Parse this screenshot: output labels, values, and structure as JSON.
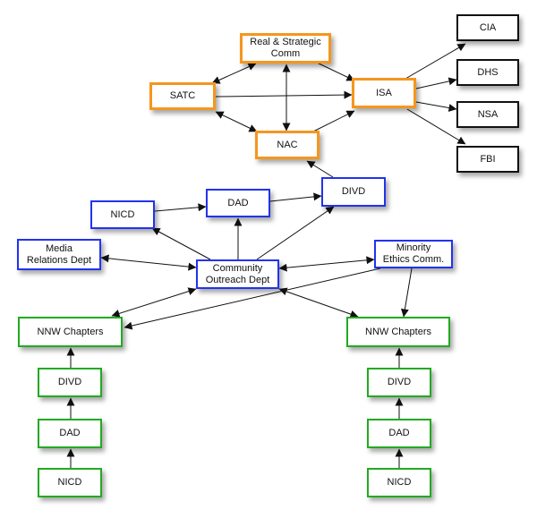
{
  "diagram": {
    "nodes": [
      {
        "id": "real-strategic-comm",
        "label": "Real & Strategic\nComm",
        "group": "orange"
      },
      {
        "id": "satc",
        "label": "SATC",
        "group": "orange"
      },
      {
        "id": "isa",
        "label": "ISA",
        "group": "orange"
      },
      {
        "id": "nac",
        "label": "NAC",
        "group": "orange"
      },
      {
        "id": "cia",
        "label": "CIA",
        "group": "black"
      },
      {
        "id": "dhs",
        "label": "DHS",
        "group": "black"
      },
      {
        "id": "nsa",
        "label": "NSA",
        "group": "black"
      },
      {
        "id": "fbi",
        "label": "FBI",
        "group": "black"
      },
      {
        "id": "divd-top",
        "label": "DIVD",
        "group": "blue"
      },
      {
        "id": "dad-top",
        "label": "DAD",
        "group": "blue"
      },
      {
        "id": "nicd-top",
        "label": "NICD",
        "group": "blue"
      },
      {
        "id": "media-relations",
        "label": "Media\nRelations Dept",
        "group": "blue"
      },
      {
        "id": "community-outreach",
        "label": "Community\nOutreach Dept",
        "group": "blue"
      },
      {
        "id": "minority-ethics",
        "label": "Minority\nEthics Comm.",
        "group": "blue"
      },
      {
        "id": "nnw-left",
        "label": "NNW Chapters",
        "group": "green"
      },
      {
        "id": "nnw-right",
        "label": "NNW Chapters",
        "group": "green"
      },
      {
        "id": "divd-left",
        "label": "DIVD",
        "group": "green"
      },
      {
        "id": "dad-left",
        "label": "DAD",
        "group": "green"
      },
      {
        "id": "nicd-left",
        "label": "NICD",
        "group": "green"
      },
      {
        "id": "divd-right",
        "label": "DIVD",
        "group": "green"
      },
      {
        "id": "dad-right",
        "label": "DAD",
        "group": "green"
      },
      {
        "id": "nicd-right",
        "label": "NICD",
        "group": "green"
      }
    ],
    "edges": [
      {
        "from": "real-strategic-comm",
        "to": "satc",
        "direction": "both"
      },
      {
        "from": "real-strategic-comm",
        "to": "isa",
        "direction": "forward"
      },
      {
        "from": "real-strategic-comm",
        "to": "nac",
        "direction": "both"
      },
      {
        "from": "satc",
        "to": "isa",
        "direction": "forward"
      },
      {
        "from": "satc",
        "to": "nac",
        "direction": "both"
      },
      {
        "from": "nac",
        "to": "isa",
        "direction": "forward"
      },
      {
        "from": "isa",
        "to": "cia",
        "direction": "forward"
      },
      {
        "from": "isa",
        "to": "dhs",
        "direction": "forward"
      },
      {
        "from": "isa",
        "to": "nsa",
        "direction": "forward"
      },
      {
        "from": "isa",
        "to": "fbi",
        "direction": "forward"
      },
      {
        "from": "divd-top",
        "to": "nac",
        "direction": "forward"
      },
      {
        "from": "dad-top",
        "to": "divd-top",
        "direction": "forward"
      },
      {
        "from": "nicd-top",
        "to": "dad-top",
        "direction": "forward"
      },
      {
        "from": "community-outreach",
        "to": "nicd-top",
        "direction": "forward"
      },
      {
        "from": "community-outreach",
        "to": "dad-top",
        "direction": "forward"
      },
      {
        "from": "community-outreach",
        "to": "divd-top",
        "direction": "forward"
      },
      {
        "from": "community-outreach",
        "to": "media-relations",
        "direction": "both"
      },
      {
        "from": "community-outreach",
        "to": "minority-ethics",
        "direction": "both"
      },
      {
        "from": "community-outreach",
        "to": "nnw-left",
        "direction": "both"
      },
      {
        "from": "community-outreach",
        "to": "nnw-right",
        "direction": "both"
      },
      {
        "from": "minority-ethics",
        "to": "nnw-left",
        "direction": "forward"
      },
      {
        "from": "minority-ethics",
        "to": "nnw-right",
        "direction": "forward"
      },
      {
        "from": "divd-left",
        "to": "nnw-left",
        "direction": "forward"
      },
      {
        "from": "dad-left",
        "to": "divd-left",
        "direction": "forward"
      },
      {
        "from": "nicd-left",
        "to": "dad-left",
        "direction": "forward"
      },
      {
        "from": "divd-right",
        "to": "nnw-right",
        "direction": "forward"
      },
      {
        "from": "dad-right",
        "to": "divd-right",
        "direction": "forward"
      },
      {
        "from": "nicd-right",
        "to": "dad-right",
        "direction": "forward"
      }
    ]
  }
}
